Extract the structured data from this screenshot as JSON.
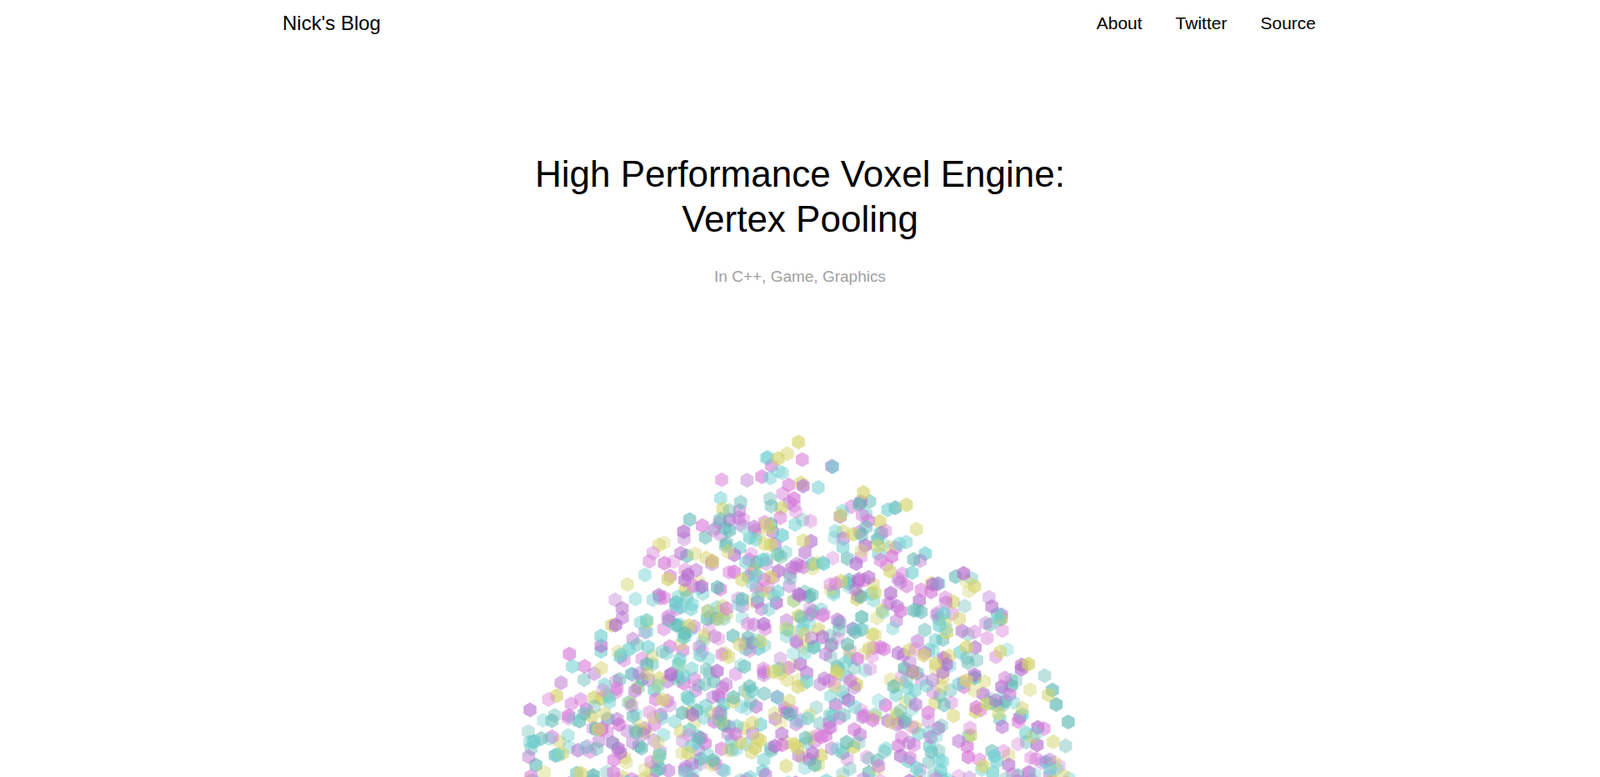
{
  "header": {
    "title": "Nick's Blog",
    "nav": [
      "About",
      "Twitter",
      "Source"
    ]
  },
  "post": {
    "title": "High Performance Voxel Engine: Vertex Pooling",
    "category": "In C++, Game, Graphics"
  }
}
